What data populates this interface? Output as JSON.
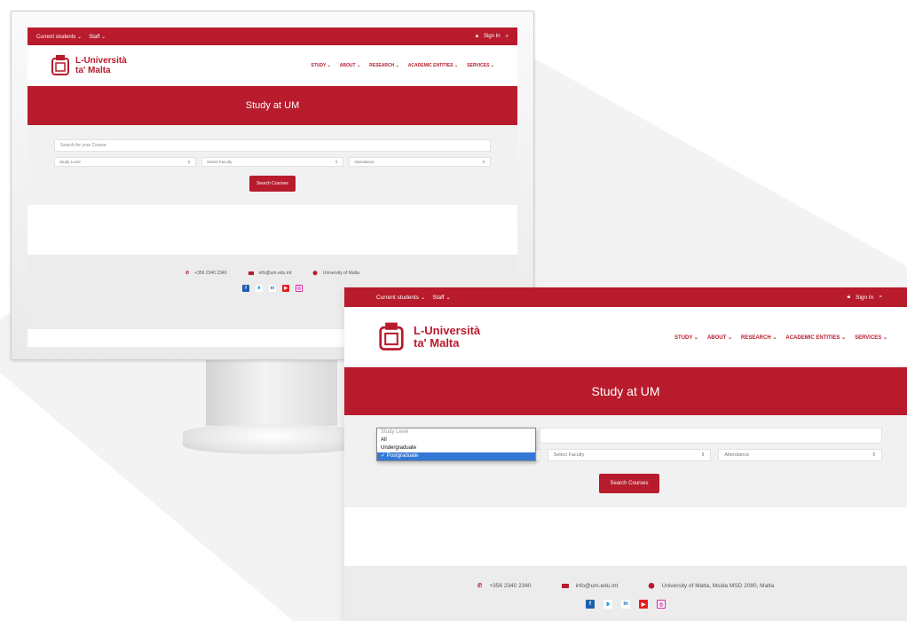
{
  "site": {
    "topbar": {
      "current_students": "Current students ⌄",
      "staff": "Staff ⌄",
      "sign_in": "Sign In"
    },
    "logo": {
      "line1": "L-Università",
      "line2": "ta' Malta"
    },
    "nav": [
      "STUDY ⌄",
      "ABOUT ⌄",
      "RESEARCH ⌄",
      "ACADEMIC ENTITIES ⌄",
      "SERVICES ⌄"
    ],
    "hero_title": "Study at UM",
    "search": {
      "placeholder": "Search for your Course",
      "study_level": "Study Level",
      "faculty": "Select Faculty",
      "attendance": "Attendance",
      "button": "Search Courses"
    },
    "dropdown_options": [
      "Study Level",
      "All",
      "Undergraduate",
      "Postgraduate"
    ],
    "footer": {
      "phone": "+356 2340 2340",
      "email": "info@um.edu.mt",
      "address": "University of Malta, Msida MSD 2080, Malta",
      "address_short": "University of Malta"
    }
  },
  "icons": {
    "phone": "phone-icon",
    "email": "envelope-icon",
    "location": "map-pin-icon",
    "lock": "lock-icon",
    "search": "search-icon",
    "facebook": "facebook-icon",
    "twitter": "twitter-icon",
    "linkedin": "linkedin-icon",
    "youtube": "youtube-icon",
    "instagram": "instagram-icon"
  },
  "colors": {
    "brand_red": "#b81b2c",
    "footer_grey": "#ececec",
    "select_blue": "#3478d6"
  }
}
